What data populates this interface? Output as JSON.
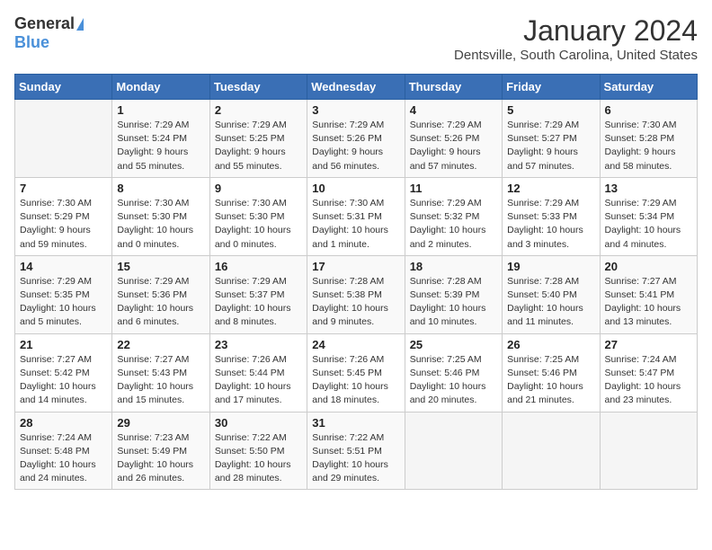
{
  "header": {
    "logo_general": "General",
    "logo_blue": "Blue",
    "month_title": "January 2024",
    "location": "Dentsville, South Carolina, United States"
  },
  "days_of_week": [
    "Sunday",
    "Monday",
    "Tuesday",
    "Wednesday",
    "Thursday",
    "Friday",
    "Saturday"
  ],
  "weeks": [
    [
      {
        "day": "",
        "sunrise": "",
        "sunset": "",
        "daylight": ""
      },
      {
        "day": "1",
        "sunrise": "7:29 AM",
        "sunset": "5:24 PM",
        "daylight": "9 hours and 55 minutes."
      },
      {
        "day": "2",
        "sunrise": "7:29 AM",
        "sunset": "5:25 PM",
        "daylight": "9 hours and 55 minutes."
      },
      {
        "day": "3",
        "sunrise": "7:29 AM",
        "sunset": "5:26 PM",
        "daylight": "9 hours and 56 minutes."
      },
      {
        "day": "4",
        "sunrise": "7:29 AM",
        "sunset": "5:26 PM",
        "daylight": "9 hours and 57 minutes."
      },
      {
        "day": "5",
        "sunrise": "7:29 AM",
        "sunset": "5:27 PM",
        "daylight": "9 hours and 57 minutes."
      },
      {
        "day": "6",
        "sunrise": "7:30 AM",
        "sunset": "5:28 PM",
        "daylight": "9 hours and 58 minutes."
      }
    ],
    [
      {
        "day": "7",
        "sunrise": "7:30 AM",
        "sunset": "5:29 PM",
        "daylight": "9 hours and 59 minutes."
      },
      {
        "day": "8",
        "sunrise": "7:30 AM",
        "sunset": "5:30 PM",
        "daylight": "10 hours and 0 minutes."
      },
      {
        "day": "9",
        "sunrise": "7:30 AM",
        "sunset": "5:30 PM",
        "daylight": "10 hours and 0 minutes."
      },
      {
        "day": "10",
        "sunrise": "7:30 AM",
        "sunset": "5:31 PM",
        "daylight": "10 hours and 1 minute."
      },
      {
        "day": "11",
        "sunrise": "7:29 AM",
        "sunset": "5:32 PM",
        "daylight": "10 hours and 2 minutes."
      },
      {
        "day": "12",
        "sunrise": "7:29 AM",
        "sunset": "5:33 PM",
        "daylight": "10 hours and 3 minutes."
      },
      {
        "day": "13",
        "sunrise": "7:29 AM",
        "sunset": "5:34 PM",
        "daylight": "10 hours and 4 minutes."
      }
    ],
    [
      {
        "day": "14",
        "sunrise": "7:29 AM",
        "sunset": "5:35 PM",
        "daylight": "10 hours and 5 minutes."
      },
      {
        "day": "15",
        "sunrise": "7:29 AM",
        "sunset": "5:36 PM",
        "daylight": "10 hours and 6 minutes."
      },
      {
        "day": "16",
        "sunrise": "7:29 AM",
        "sunset": "5:37 PM",
        "daylight": "10 hours and 8 minutes."
      },
      {
        "day": "17",
        "sunrise": "7:28 AM",
        "sunset": "5:38 PM",
        "daylight": "10 hours and 9 minutes."
      },
      {
        "day": "18",
        "sunrise": "7:28 AM",
        "sunset": "5:39 PM",
        "daylight": "10 hours and 10 minutes."
      },
      {
        "day": "19",
        "sunrise": "7:28 AM",
        "sunset": "5:40 PM",
        "daylight": "10 hours and 11 minutes."
      },
      {
        "day": "20",
        "sunrise": "7:27 AM",
        "sunset": "5:41 PM",
        "daylight": "10 hours and 13 minutes."
      }
    ],
    [
      {
        "day": "21",
        "sunrise": "7:27 AM",
        "sunset": "5:42 PM",
        "daylight": "10 hours and 14 minutes."
      },
      {
        "day": "22",
        "sunrise": "7:27 AM",
        "sunset": "5:43 PM",
        "daylight": "10 hours and 15 minutes."
      },
      {
        "day": "23",
        "sunrise": "7:26 AM",
        "sunset": "5:44 PM",
        "daylight": "10 hours and 17 minutes."
      },
      {
        "day": "24",
        "sunrise": "7:26 AM",
        "sunset": "5:45 PM",
        "daylight": "10 hours and 18 minutes."
      },
      {
        "day": "25",
        "sunrise": "7:25 AM",
        "sunset": "5:46 PM",
        "daylight": "10 hours and 20 minutes."
      },
      {
        "day": "26",
        "sunrise": "7:25 AM",
        "sunset": "5:46 PM",
        "daylight": "10 hours and 21 minutes."
      },
      {
        "day": "27",
        "sunrise": "7:24 AM",
        "sunset": "5:47 PM",
        "daylight": "10 hours and 23 minutes."
      }
    ],
    [
      {
        "day": "28",
        "sunrise": "7:24 AM",
        "sunset": "5:48 PM",
        "daylight": "10 hours and 24 minutes."
      },
      {
        "day": "29",
        "sunrise": "7:23 AM",
        "sunset": "5:49 PM",
        "daylight": "10 hours and 26 minutes."
      },
      {
        "day": "30",
        "sunrise": "7:22 AM",
        "sunset": "5:50 PM",
        "daylight": "10 hours and 28 minutes."
      },
      {
        "day": "31",
        "sunrise": "7:22 AM",
        "sunset": "5:51 PM",
        "daylight": "10 hours and 29 minutes."
      },
      {
        "day": "",
        "sunrise": "",
        "sunset": "",
        "daylight": ""
      },
      {
        "day": "",
        "sunrise": "",
        "sunset": "",
        "daylight": ""
      },
      {
        "day": "",
        "sunrise": "",
        "sunset": "",
        "daylight": ""
      }
    ]
  ]
}
